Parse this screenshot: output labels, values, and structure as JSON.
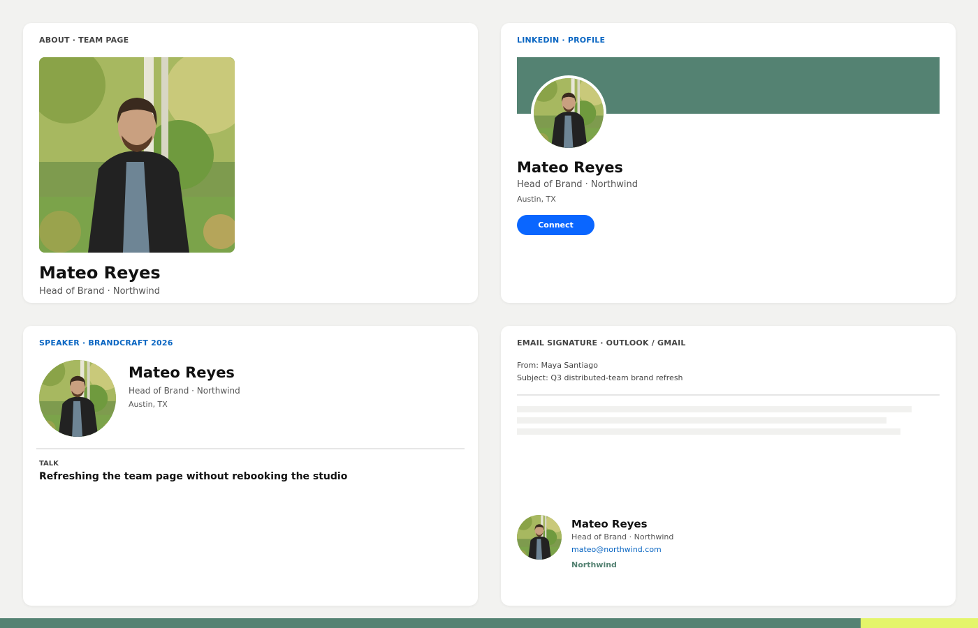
{
  "colors": {
    "page_bg": "#f2f2f0",
    "brand_green": "#548272",
    "accent_lime": "#e4f56a",
    "linkedin_blue": "#0a66c2",
    "connect_button": "#0a66ff"
  },
  "person": {
    "name": "Mateo Reyes",
    "role": "Head of Brand · Northwind",
    "location": "Austin, TX",
    "email": "mateo@northwind.com",
    "company": "Northwind"
  },
  "team_card": {
    "eyebrow": "ABOUT · TEAM PAGE",
    "photo_icon": "portrait-photo"
  },
  "linkedin_card": {
    "eyebrow": "LINKEDIN · PROFILE",
    "connect_label": "Connect"
  },
  "speaker_card": {
    "eyebrow": "SPEAKER · BRANDCRAFT 2026",
    "talk_label": "TALK",
    "talk_title": "Refreshing the team page without rebooking the studio"
  },
  "email_card": {
    "eyebrow": "EMAIL SIGNATURE · OUTLOOK / GMAIL",
    "from_line": "From: Maya Santiago",
    "subject_line": "Subject: Q3 distributed-team brand refresh"
  }
}
